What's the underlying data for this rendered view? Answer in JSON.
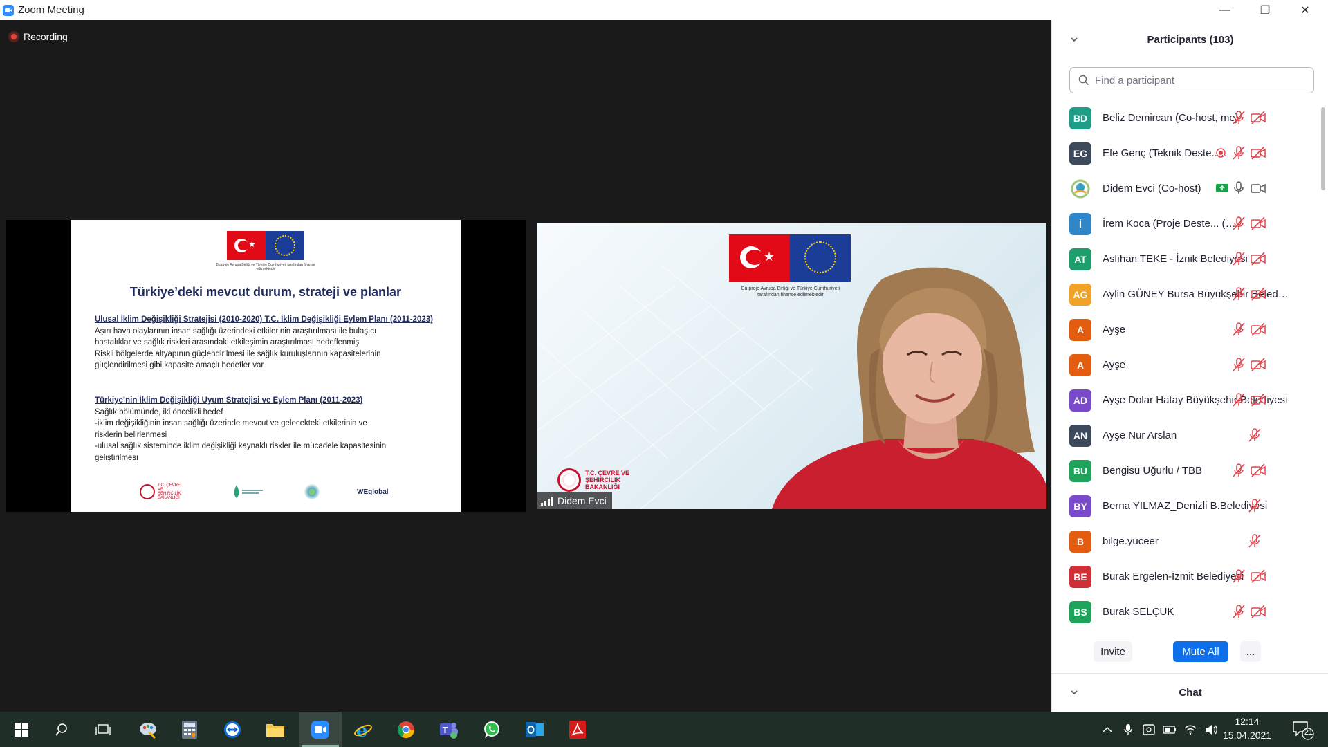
{
  "window": {
    "title": "Zoom Meeting",
    "minimize": "—",
    "maximize": "❐",
    "close": "✕"
  },
  "meeting": {
    "recording_label": "Recording"
  },
  "slide": {
    "funder_note": "Bu proje Avrupa Birliği ve Türkiye Cumhuriyeti tarafından finanse edilmektedir",
    "title": "Türkiye’deki mevcut durum, strateji ve planlar",
    "section1_heading": "Ulusal İklim Değişikliği Stratejisi (2010-2020) T.C. İklim Değişikliği Eylem Planı (2011-2023)",
    "section1_lines": [
      "Aşırı hava olaylarının insan sağlığı üzerindeki etkilerinin araştırılması ile bulaşıcı",
      "hastalıklar ve sağlık riskleri arasındaki etkileşimin araştırılması hedeflenmiş",
      "Riskli bölgelerde altyapının güçlendirilmesi ile sağlık kuruluşlarının kapasitelerinin",
      "güçlendirilmesi gibi kapasite amaçlı hedefler var"
    ],
    "section2_heading": "Türkiye’nin İklim Değişikliği Uyum Stratejisi ve Eylem Planı (2011-2023)",
    "section2_lines": [
      "Sağlık bölümünde, iki öncelikli hedef",
      "-iklim değişikliğinin insan sağlığı üzerinde mevcut ve gelecekteki etkilerinin ve",
      "risklerin belirlenmesi",
      "-ulusal sağlık sisteminde iklim değişikliği kaynaklı riskler ile mücadele kapasitesinin",
      "geliştirilmesi"
    ],
    "footer_logos": [
      "T.C. ÇEVRE VE ŞEHİRCİLİK BAKANLIĞI",
      "",
      "",
      "WEglobal"
    ]
  },
  "camera": {
    "funder_note": "Bu proje Avrupa Birliği ve Türkiye Cumhuriyeti tarafından finanse edilmektedir",
    "ministry": "T.C. ÇEVRE VE ŞEHİRCİLİK BAKANLIĞI",
    "speaker_name": "Didem Evci"
  },
  "participants": {
    "header": "Participants (103)",
    "search_placeholder": "Find a participant",
    "list": [
      {
        "initials": "BD",
        "name": "Beliz Demircan (Co-host, me)",
        "color": "#1f9e87",
        "mic": "muted",
        "video": "off"
      },
      {
        "initials": "EG",
        "name": "Efe Genç (Teknik Deste...  (Host)",
        "color": "#3d4a5c",
        "mic": "muted",
        "video": "off",
        "recording": true
      },
      {
        "initials": "",
        "name": "Didem Evci (Co-host)",
        "color": "#ffffff",
        "mic": "on",
        "video": "on",
        "sharing": true,
        "photo": true
      },
      {
        "initials": "İ",
        "name": "İrem Koca (Proje Deste...  (Co-host)",
        "color": "#2e86c8",
        "mic": "muted",
        "video": "off"
      },
      {
        "initials": "AT",
        "name": "Aslıhan TEKE - İznik Belediyesi",
        "color": "#1f9e6d",
        "mic": "muted",
        "video": "off"
      },
      {
        "initials": "AG",
        "name": "Aylin GÜNEY Bursa Büyükşehir Belediyesi",
        "color": "#f0a229",
        "mic": "muted",
        "video": "off"
      },
      {
        "initials": "A",
        "name": "Ayşe",
        "color": "#e35d10",
        "mic": "muted",
        "video": "off"
      },
      {
        "initials": "A",
        "name": "Ayşe",
        "color": "#e35d10",
        "mic": "muted",
        "video": "off"
      },
      {
        "initials": "AD",
        "name": "Ayşe Dolar Hatay Büyükşehir Belediyesi",
        "color": "#7a4bc8",
        "mic": "muted",
        "video": "off"
      },
      {
        "initials": "AN",
        "name": "Ayşe Nur Arslan",
        "color": "#3d4a5c",
        "mic": "muted",
        "video": "none"
      },
      {
        "initials": "BU",
        "name": "Bengisu Uğurlu / TBB",
        "color": "#1fa35a",
        "mic": "muted",
        "video": "off"
      },
      {
        "initials": "BY",
        "name": "Berna YILMAZ_Denizli B.Belediyesi",
        "color": "#7a4bc8",
        "mic": "muted",
        "video": "none"
      },
      {
        "initials": "B",
        "name": "bilge.yuceer",
        "color": "#e35d10",
        "mic": "muted",
        "video": "none"
      },
      {
        "initials": "BE",
        "name": "Burak Ergelen-İzmit Belediyesi",
        "color": "#cf2f36",
        "mic": "muted",
        "video": "off"
      },
      {
        "initials": "BS",
        "name": "Burak SELÇUK",
        "color": "#1fa35a",
        "mic": "muted",
        "video": "off"
      }
    ],
    "invite_label": "Invite",
    "mute_all_label": "Mute All",
    "more_label": "...",
    "chat_label": "Chat"
  },
  "taskbar": {
    "time": "12:14",
    "date": "15.04.2021",
    "notification_count": "21",
    "apps": [
      "start",
      "search",
      "task-view",
      "paint",
      "calculator",
      "teamviewer",
      "file-explorer",
      "zoom",
      "internet-explorer",
      "chrome",
      "teams",
      "whatsapp",
      "outlook",
      "acrobat"
    ]
  },
  "colors": {
    "accent": "#0e71eb",
    "muted_red": "#e0404a",
    "taskbar_bg": "#1f2e27",
    "meeting_bg": "#1a1a1a"
  }
}
